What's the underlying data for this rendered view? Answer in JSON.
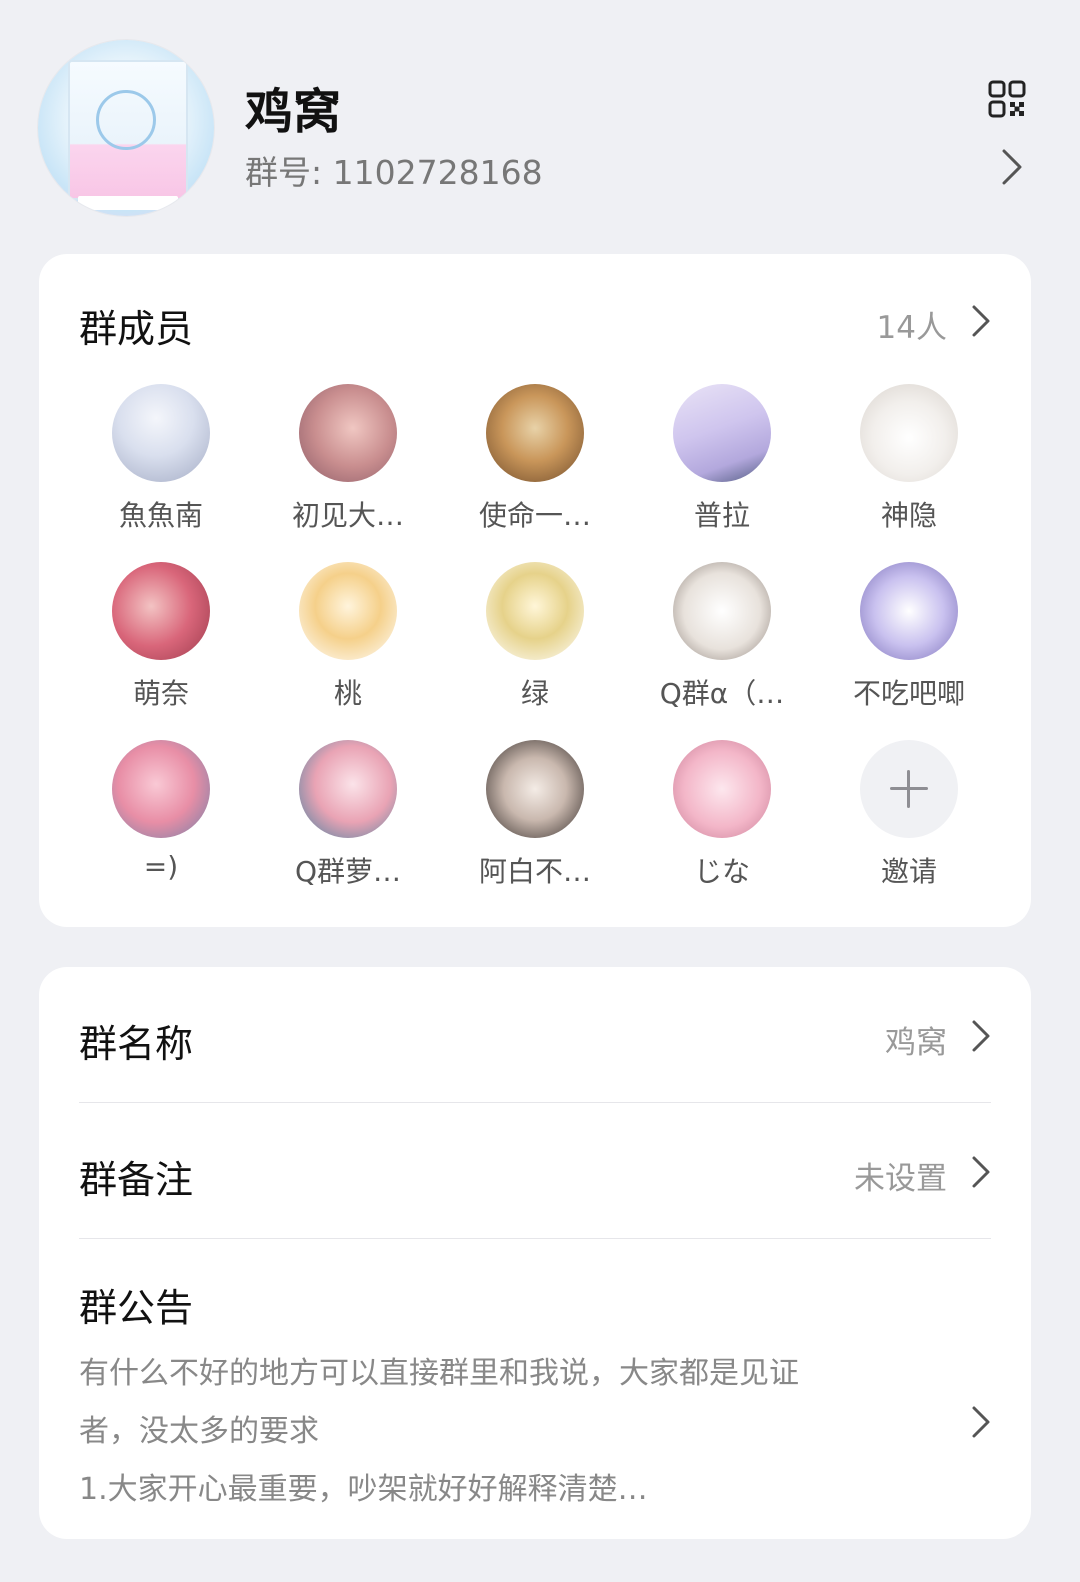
{
  "header": {
    "group_name": "鸡窝",
    "group_id_text": "群号: 1102728168"
  },
  "members": {
    "title": "群成员",
    "count": "14人",
    "items": [
      {
        "name": "魚魚南",
        "avatar_color": "#c9d4e6"
      },
      {
        "name": "初见大…",
        "avatar_color": "#c98e8f"
      },
      {
        "name": "使命一…",
        "avatar_color": "#b07a4d"
      },
      {
        "name": "普拉",
        "avatar_color": "#cfc5ee"
      },
      {
        "name": "神隐",
        "avatar_color": "#eeeeee"
      },
      {
        "name": "萌奈",
        "avatar_color": "#d9667a"
      },
      {
        "name": "桃",
        "avatar_color": "#f5d08a"
      },
      {
        "name": "绿",
        "avatar_color": "#e6d28a"
      },
      {
        "name": "Q群α（…",
        "avatar_color": "#e8e2dc"
      },
      {
        "name": "不吃吧唧",
        "avatar_color": "#c9c1ef"
      },
      {
        "name": "=)",
        "avatar_color": "#e88ea6"
      },
      {
        "name": "Q群萝…",
        "avatar_color": "#e9a3b4"
      },
      {
        "name": "阿白不…",
        "avatar_color": "#8c7c74"
      },
      {
        "name": "じな",
        "avatar_color": "#f3b6c8"
      }
    ],
    "invite_label": "邀请"
  },
  "settings": {
    "name_row": {
      "title": "群名称",
      "value": "鸡窝"
    },
    "remark_row": {
      "title": "群备注",
      "value": "未设置"
    },
    "notice_row": {
      "title": "群公告",
      "text_line1": "有什么不好的地方可以直接群里和我说，大家都是见证",
      "text_line2": "者，没太多的要求",
      "text_line3": "1.大家开心最重要，吵架就好好解释清楚…"
    }
  }
}
